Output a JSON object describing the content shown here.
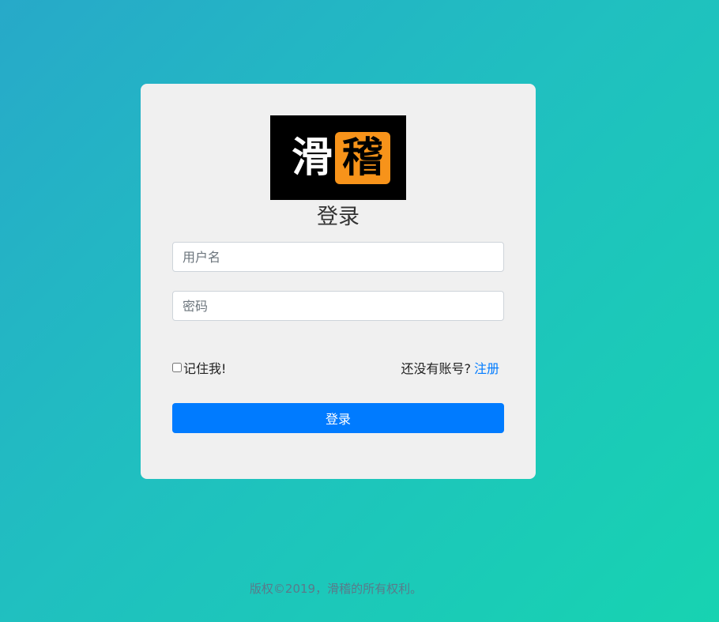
{
  "logo": {
    "left_text": "滑",
    "right_text": "稽",
    "bg_color": "#000000",
    "accent_color": "#f7931a"
  },
  "form": {
    "title": "登录",
    "username_placeholder": "用户名",
    "password_placeholder": "密码",
    "remember_label": "记住我!",
    "no_account_text": "还没有账号?",
    "register_link": "注册",
    "submit_label": "登录"
  },
  "footer": {
    "copyright": "版权©2019，滑稽的所有权利。"
  },
  "colors": {
    "primary": "#007bff",
    "card_bg": "#f0f0f0"
  }
}
